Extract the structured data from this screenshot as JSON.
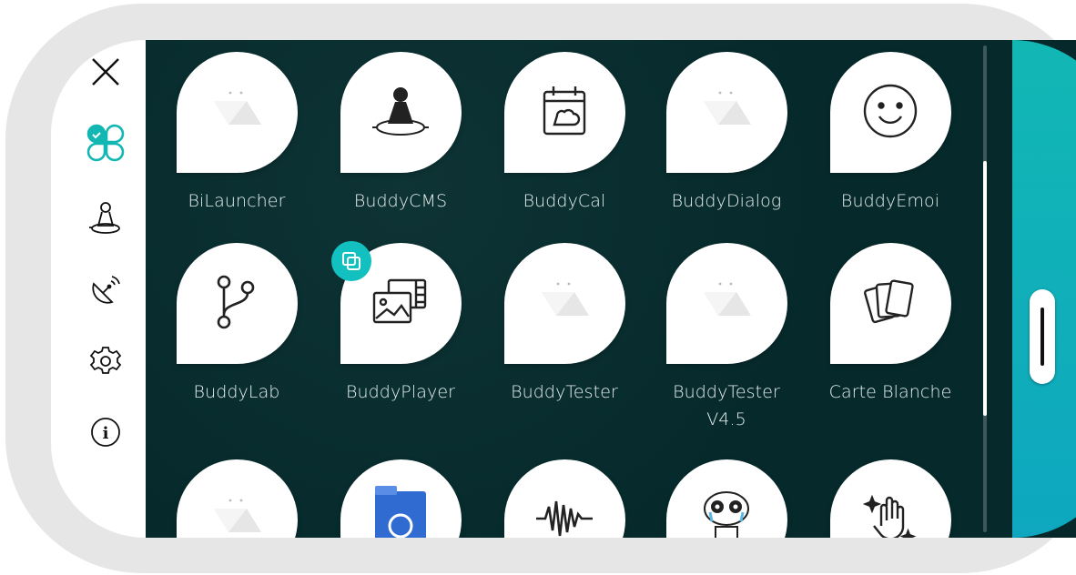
{
  "sidebar": {
    "items": [
      {
        "icon": "close-icon"
      },
      {
        "icon": "apps-clover-icon",
        "active": true
      },
      {
        "icon": "buddy-robot-icon"
      },
      {
        "icon": "satellite-dish-icon"
      },
      {
        "icon": "gear-icon"
      },
      {
        "icon": "info-icon"
      }
    ],
    "accent": "#12b7b4"
  },
  "apps": [
    {
      "label": "BiLauncher",
      "icon": "default-app-icon"
    },
    {
      "label": "BuddyCMS",
      "icon": "buddy-robot-icon"
    },
    {
      "label": "BuddyCal",
      "icon": "calendar-icon"
    },
    {
      "label": "BuddyDialog",
      "icon": "default-app-icon"
    },
    {
      "label": "BuddyEmoi",
      "icon": "smiley-icon"
    },
    {
      "label": "BuddyLab",
      "icon": "branch-icon"
    },
    {
      "label": "BuddyPlayer",
      "icon": "media-gallery-icon",
      "badge": "copy-icon"
    },
    {
      "label": "BuddyTester",
      "icon": "default-app-icon"
    },
    {
      "label": "BuddyTester V4.5",
      "label_line1": "BuddyTester",
      "label_line2": "V4.5",
      "icon": "default-app-icon"
    },
    {
      "label": "Carte Blanche",
      "icon": "cards-icon"
    },
    {
      "label": "",
      "icon": "default-app-icon"
    },
    {
      "label": "",
      "icon": "folder-icon"
    },
    {
      "label": "",
      "icon": "waveform-icon"
    },
    {
      "label": "",
      "icon": "robot-face-icon"
    },
    {
      "label": "",
      "icon": "hand-sparkle-icon"
    }
  ],
  "colors": {
    "background": "#06282a",
    "teal": "#12b7b4",
    "bubble": "#ffffff"
  }
}
